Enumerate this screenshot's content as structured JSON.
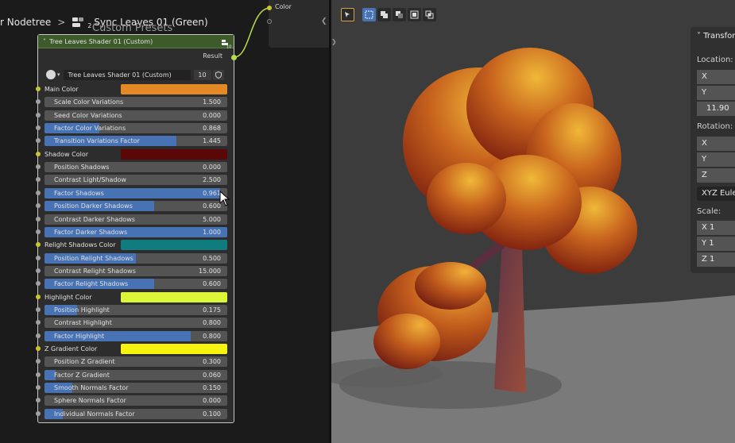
{
  "breadcrumb": {
    "root": "r Nodetree",
    "separator": ">",
    "node_group": "Sync Leaves 01 (Green)",
    "user_count": "2"
  },
  "custom_presets_label": "Custom Presets",
  "node": {
    "title": "Tree Leaves Shader 01 (Custom)",
    "output_label": "Result",
    "group_name": "Tree Leaves Shader 01 (Custom)",
    "group_users": "10",
    "badge_count": "10",
    "colors": {
      "header": "#3d5a2a",
      "color_socket": "#c7c729",
      "value_socket": "#a1a1a1",
      "slider_fill": "#4772b3"
    },
    "inputs": [
      {
        "kind": "color",
        "label": "Main Color",
        "color": "#e38a26"
      },
      {
        "kind": "value",
        "label": "Scale Color Variations",
        "value": "1.500",
        "fill": 0
      },
      {
        "kind": "value",
        "label": "Seed Color Variations",
        "value": "0.000",
        "fill": 0
      },
      {
        "kind": "value",
        "label": "Factor Color Variations",
        "value": "0.868",
        "fill": 0.3
      },
      {
        "kind": "value",
        "label": "Transition Variations Factor",
        "value": "1.445",
        "fill": 0.72
      },
      {
        "kind": "color",
        "label": "Shadow Color",
        "color": "#5c0707"
      },
      {
        "kind": "value",
        "label": "Position Shadows",
        "value": "0.000",
        "fill": 0
      },
      {
        "kind": "value",
        "label": "Contrast Light/Shadow",
        "value": "2.500",
        "fill": 0
      },
      {
        "kind": "value",
        "label": "Factor Shadows",
        "value": "0.961",
        "fill": 0.96
      },
      {
        "kind": "value",
        "label": "Position Darker Shadows",
        "value": "0.600",
        "fill": 0.6
      },
      {
        "kind": "value",
        "label": "Contrast Darker Shadows",
        "value": "5.000",
        "fill": 0
      },
      {
        "kind": "value",
        "label": "Factor Darker Shadows",
        "value": "1.000",
        "fill": 1.0
      },
      {
        "kind": "color",
        "label": "Relight Shadows Color",
        "color": "#117c80"
      },
      {
        "kind": "value",
        "label": "Position Relight Shadows",
        "value": "0.500",
        "fill": 0.5
      },
      {
        "kind": "value",
        "label": "Contrast Relight Shadows",
        "value": "15.000",
        "fill": 0
      },
      {
        "kind": "value",
        "label": "Factor Relight Shadows",
        "value": "0.600",
        "fill": 0.6
      },
      {
        "kind": "color",
        "label": "Highlight Color",
        "color": "#dcf63a"
      },
      {
        "kind": "value",
        "label": "Position Highlight",
        "value": "0.175",
        "fill": 0.18
      },
      {
        "kind": "value",
        "label": "Contrast Highlight",
        "value": "0.800",
        "fill": 0
      },
      {
        "kind": "value",
        "label": "Factor Highlight",
        "value": "0.800",
        "fill": 0.8
      },
      {
        "kind": "color",
        "label": "Z Gradient Color",
        "color": "#f6f310"
      },
      {
        "kind": "value",
        "label": "Position Z Gradient",
        "value": "0.300",
        "fill": 0
      },
      {
        "kind": "value",
        "label": "Factor Z Gradient",
        "value": "0.060",
        "fill": 0.06
      },
      {
        "kind": "value",
        "label": "Smooth Normals Factor",
        "value": "0.150",
        "fill": 0.15
      },
      {
        "kind": "value",
        "label": "Sphere Normals Factor",
        "value": "0.000",
        "fill": 0
      },
      {
        "kind": "value",
        "label": "Individual Normals Factor",
        "value": "0.100",
        "fill": 0.1
      }
    ]
  },
  "color_node": {
    "title": "Color"
  },
  "viewport": {
    "panel": {
      "header": "Transform",
      "location_label": "Location:",
      "location": [
        {
          "axis": "X",
          "value": ""
        },
        {
          "axis": "Y",
          "value": ""
        },
        {
          "axis": "",
          "value": "11.90"
        }
      ],
      "rotation_label": "Rotation:",
      "rotation": [
        {
          "axis": "X",
          "value": ""
        },
        {
          "axis": "Y",
          "value": ""
        },
        {
          "axis": "Z",
          "value": ""
        }
      ],
      "rotation_mode": "XYZ Euler",
      "scale_label": "Scale:",
      "scale": [
        {
          "axis": "X",
          "value": "1"
        },
        {
          "axis": "Y",
          "value": "1"
        },
        {
          "axis": "Z",
          "value": "1"
        }
      ]
    },
    "colors": {
      "background": "#3c3c3c",
      "floor": "#7a7a7a",
      "foliage_top": "#e3a030",
      "foliage_dark": "#7a1c0e",
      "trunk": "#5a2e3f"
    }
  }
}
